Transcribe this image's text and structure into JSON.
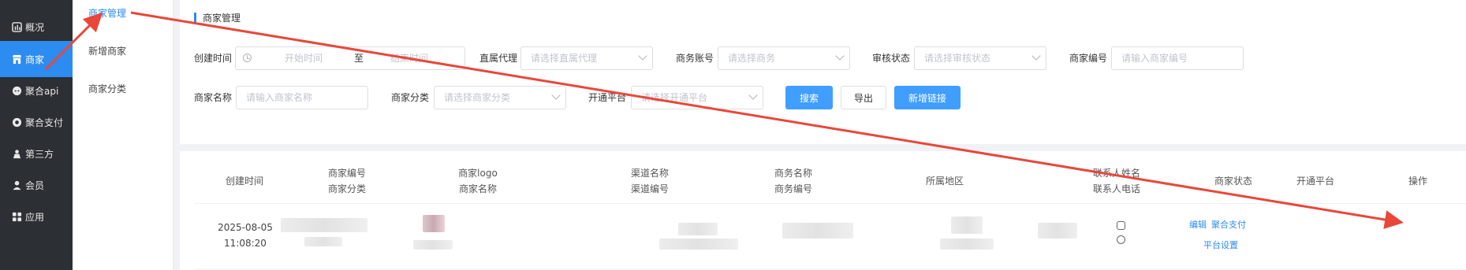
{
  "sidebar": {
    "items": [
      {
        "label": "概况",
        "icon": "bar-chart-icon"
      },
      {
        "label": "商家",
        "icon": "store-icon",
        "active": true
      },
      {
        "label": "聚合api",
        "icon": "api-icon"
      },
      {
        "label": "聚合支付",
        "icon": "payment-icon"
      },
      {
        "label": "第三方",
        "icon": "third-party-icon"
      },
      {
        "label": "会员",
        "icon": "user-icon"
      },
      {
        "label": "应用",
        "icon": "apps-icon"
      }
    ],
    "active_color": "#2d8cf0",
    "bg_color": "#2c2f33"
  },
  "submenu": {
    "items": [
      {
        "label": "商家管理",
        "active": true
      },
      {
        "label": "新增商家"
      },
      {
        "label": "商家分类"
      }
    ]
  },
  "breadcrumb": "商家管理",
  "filters": {
    "created_label": "创建时间",
    "start_placeholder": "开始时间",
    "range_sep": "至",
    "end_placeholder": "结束时间",
    "agent_label": "直属代理",
    "agent_placeholder": "请选择直属代理",
    "business_label": "商务账号",
    "business_placeholder": "请选择商务",
    "audit_label": "审核状态",
    "audit_placeholder": "请选择审核状态",
    "code_label": "商家编号",
    "code_placeholder": "请输入商家编号",
    "name_label": "商家名称",
    "name_placeholder": "请输入商家名称",
    "category_label": "商家分类",
    "category_placeholder": "请选择商家分类",
    "platform_label": "开通平台",
    "platform_placeholder": "请选择开通平台"
  },
  "buttons": {
    "search": "搜索",
    "export": "导出",
    "add_link": "新增链接"
  },
  "table": {
    "headers": [
      {
        "line1": "创建时间",
        "line2": ""
      },
      {
        "line1": "商家编号",
        "line2": "商家分类"
      },
      {
        "line1": "商家logo",
        "line2": "商家名称"
      },
      {
        "line1": "渠道名称",
        "line2": "渠道编号"
      },
      {
        "line1": "商务名称",
        "line2": "商务编号"
      },
      {
        "line1": "所属地区",
        "line2": ""
      },
      {
        "line1": "联系人姓名",
        "line2": "联系人电话"
      },
      {
        "line1": "商家状态",
        "line2": ""
      },
      {
        "line1": "开通平台",
        "line2": ""
      },
      {
        "line1": "操作",
        "line2": ""
      }
    ],
    "rows": [
      {
        "date": "2025-08-05",
        "time": "11:08:20",
        "actions": {
          "edit": "编辑",
          "pay": "聚合支付",
          "platform": "平台设置"
        }
      }
    ]
  },
  "annotation_color": "#e8473a"
}
